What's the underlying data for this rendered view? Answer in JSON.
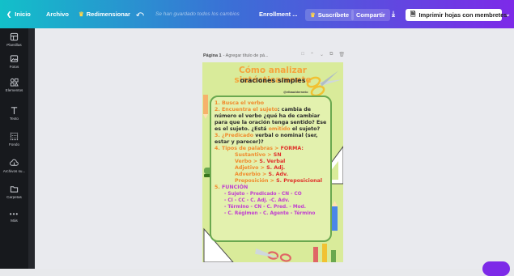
{
  "topbar": {
    "back_label": "Inicio",
    "archivo": "Archivo",
    "resize": "Redimensionar",
    "saved_status": "Se han guardado todos los cambios",
    "enrollment": "Enrollment ...",
    "subscribe": "Suscríbete",
    "share": "Compartir",
    "print": "Imprimir hojas con membretes"
  },
  "sidebar": [
    {
      "label": "Plantillas",
      "icon": "templates-icon"
    },
    {
      "label": "Fotos",
      "icon": "photos-icon"
    },
    {
      "label": "Elementos",
      "icon": "elements-icon"
    },
    {
      "label": "Texto",
      "icon": "text-icon"
    },
    {
      "label": "Fondo",
      "icon": "background-icon"
    },
    {
      "label": "Archivos su...",
      "icon": "uploads-icon"
    },
    {
      "label": "Carpetas",
      "icon": "folders-icon"
    },
    {
      "label": "Más",
      "icon": "more-icon"
    }
  ],
  "page": {
    "label": "Página 1",
    "title_placeholder": "- Agregar título de pá..."
  },
  "design": {
    "title": "Cómo analizar sintácticamente",
    "subtitle": "oraciones simples",
    "handle": "@elbaulderrario",
    "l1a": "1. Busca el ",
    "l1b": "verbo",
    "l2a": "2. Encuentra el ",
    "l2b": "sujeto",
    "l2c": ": cambia de",
    "l3": "número el verbo ¿qué ha de cambiar",
    "l4": "para que la oración tenga sentido? Ese",
    "l5a": "es el sujeto. ¿Está ",
    "l5b": "omitido",
    "l5c": " el sujeto?",
    "l6a": "3. ¿",
    "l6b": "Predicado",
    "l6c": " verbal o nominal (ser,",
    "l7": "estar y parecer)?",
    "l8a": "4. Tipos de palabras > ",
    "l8b": "FORMA:",
    "f1a": "Sustantivo > ",
    "f1b": "SN",
    "f2a": "Verbo > ",
    "f2b": "S. Verbal",
    "f3a": "Adjetivo > ",
    "f3b": "S. Adj.",
    "f4a": "Adverbio > ",
    "f4b": "S. Adv.",
    "f5a": "Preposición > ",
    "f5b": "S. Preposicional",
    "l9a": "5. ",
    "l9b": "FUNCIÓN",
    "fn1": "- Sujeto    - Predicado  - CN   - CO",
    "fn2": "- CI    - CC    - C. Adj.    -C. Adv.",
    "fn3": "- Término  - CN   - C. Pred.    - Mod.",
    "fn4": "- C. Régimen  - C. Agente  - Término"
  }
}
